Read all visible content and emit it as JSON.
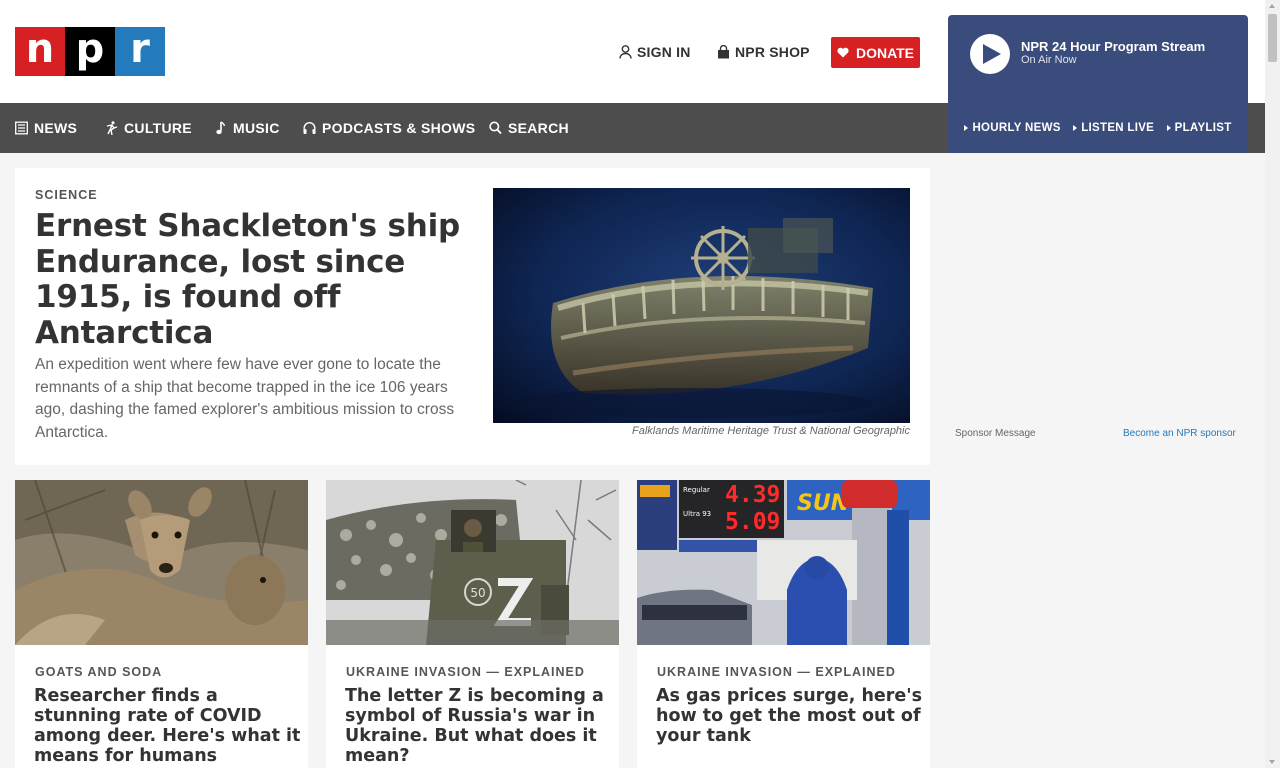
{
  "logo": {
    "letters": [
      "n",
      "p",
      "r"
    ]
  },
  "header": {
    "signin_label": "SIGN IN",
    "shop_label": "NPR SHOP",
    "donate_label": "DONATE"
  },
  "player": {
    "title": "NPR 24 Hour Program Stream",
    "subtitle": "On Air Now",
    "links": [
      "HOURLY NEWS",
      "LISTEN LIVE",
      "PLAYLIST"
    ]
  },
  "nav": {
    "items": [
      {
        "label": "NEWS",
        "icon": "newspaper-icon"
      },
      {
        "label": "CULTURE",
        "icon": "dancer-icon"
      },
      {
        "label": "MUSIC",
        "icon": "music-note-icon"
      },
      {
        "label": "PODCASTS & SHOWS",
        "icon": "headphones-icon"
      },
      {
        "label": "SEARCH",
        "icon": "search-icon"
      }
    ]
  },
  "featured": {
    "slug": "SCIENCE",
    "title": "Ernest Shackleton's ship Endurance, lost since 1915, is found off Antarctica",
    "teaser": "An expedition went where few have ever gone to locate the remnants of a ship that become trapped in the ice 106 years ago, dashing the famed explorer's ambitious mission to cross Antarctica.",
    "credit": "Falklands Maritime Heritage Trust & National Geographic"
  },
  "sidebar": {
    "sponsor_label": "Sponsor Message",
    "sponsor_link": "Become an NPR sponsor"
  },
  "cards": [
    {
      "slug": "GOATS AND SODA",
      "title": "Researcher finds a stunning rate of COVID among deer. Here's what it means for humans"
    },
    {
      "slug": "UKRAINE INVASION — EXPLAINED",
      "title": "The letter Z is becoming a symbol of Russia's war in Ukraine. But what does it mean?"
    },
    {
      "slug": "UKRAINE INVASION — EXPLAINED",
      "title": "As gas prices surge, here's how to get the most out of your tank"
    }
  ],
  "gas_prices": {
    "regular": "4.39",
    "ultra": "5.09"
  },
  "colors": {
    "npr_red": "#d62021",
    "npr_blue": "#237bbd",
    "nav_bg": "#4d4d4d",
    "player_bg": "#3a4c7c"
  }
}
